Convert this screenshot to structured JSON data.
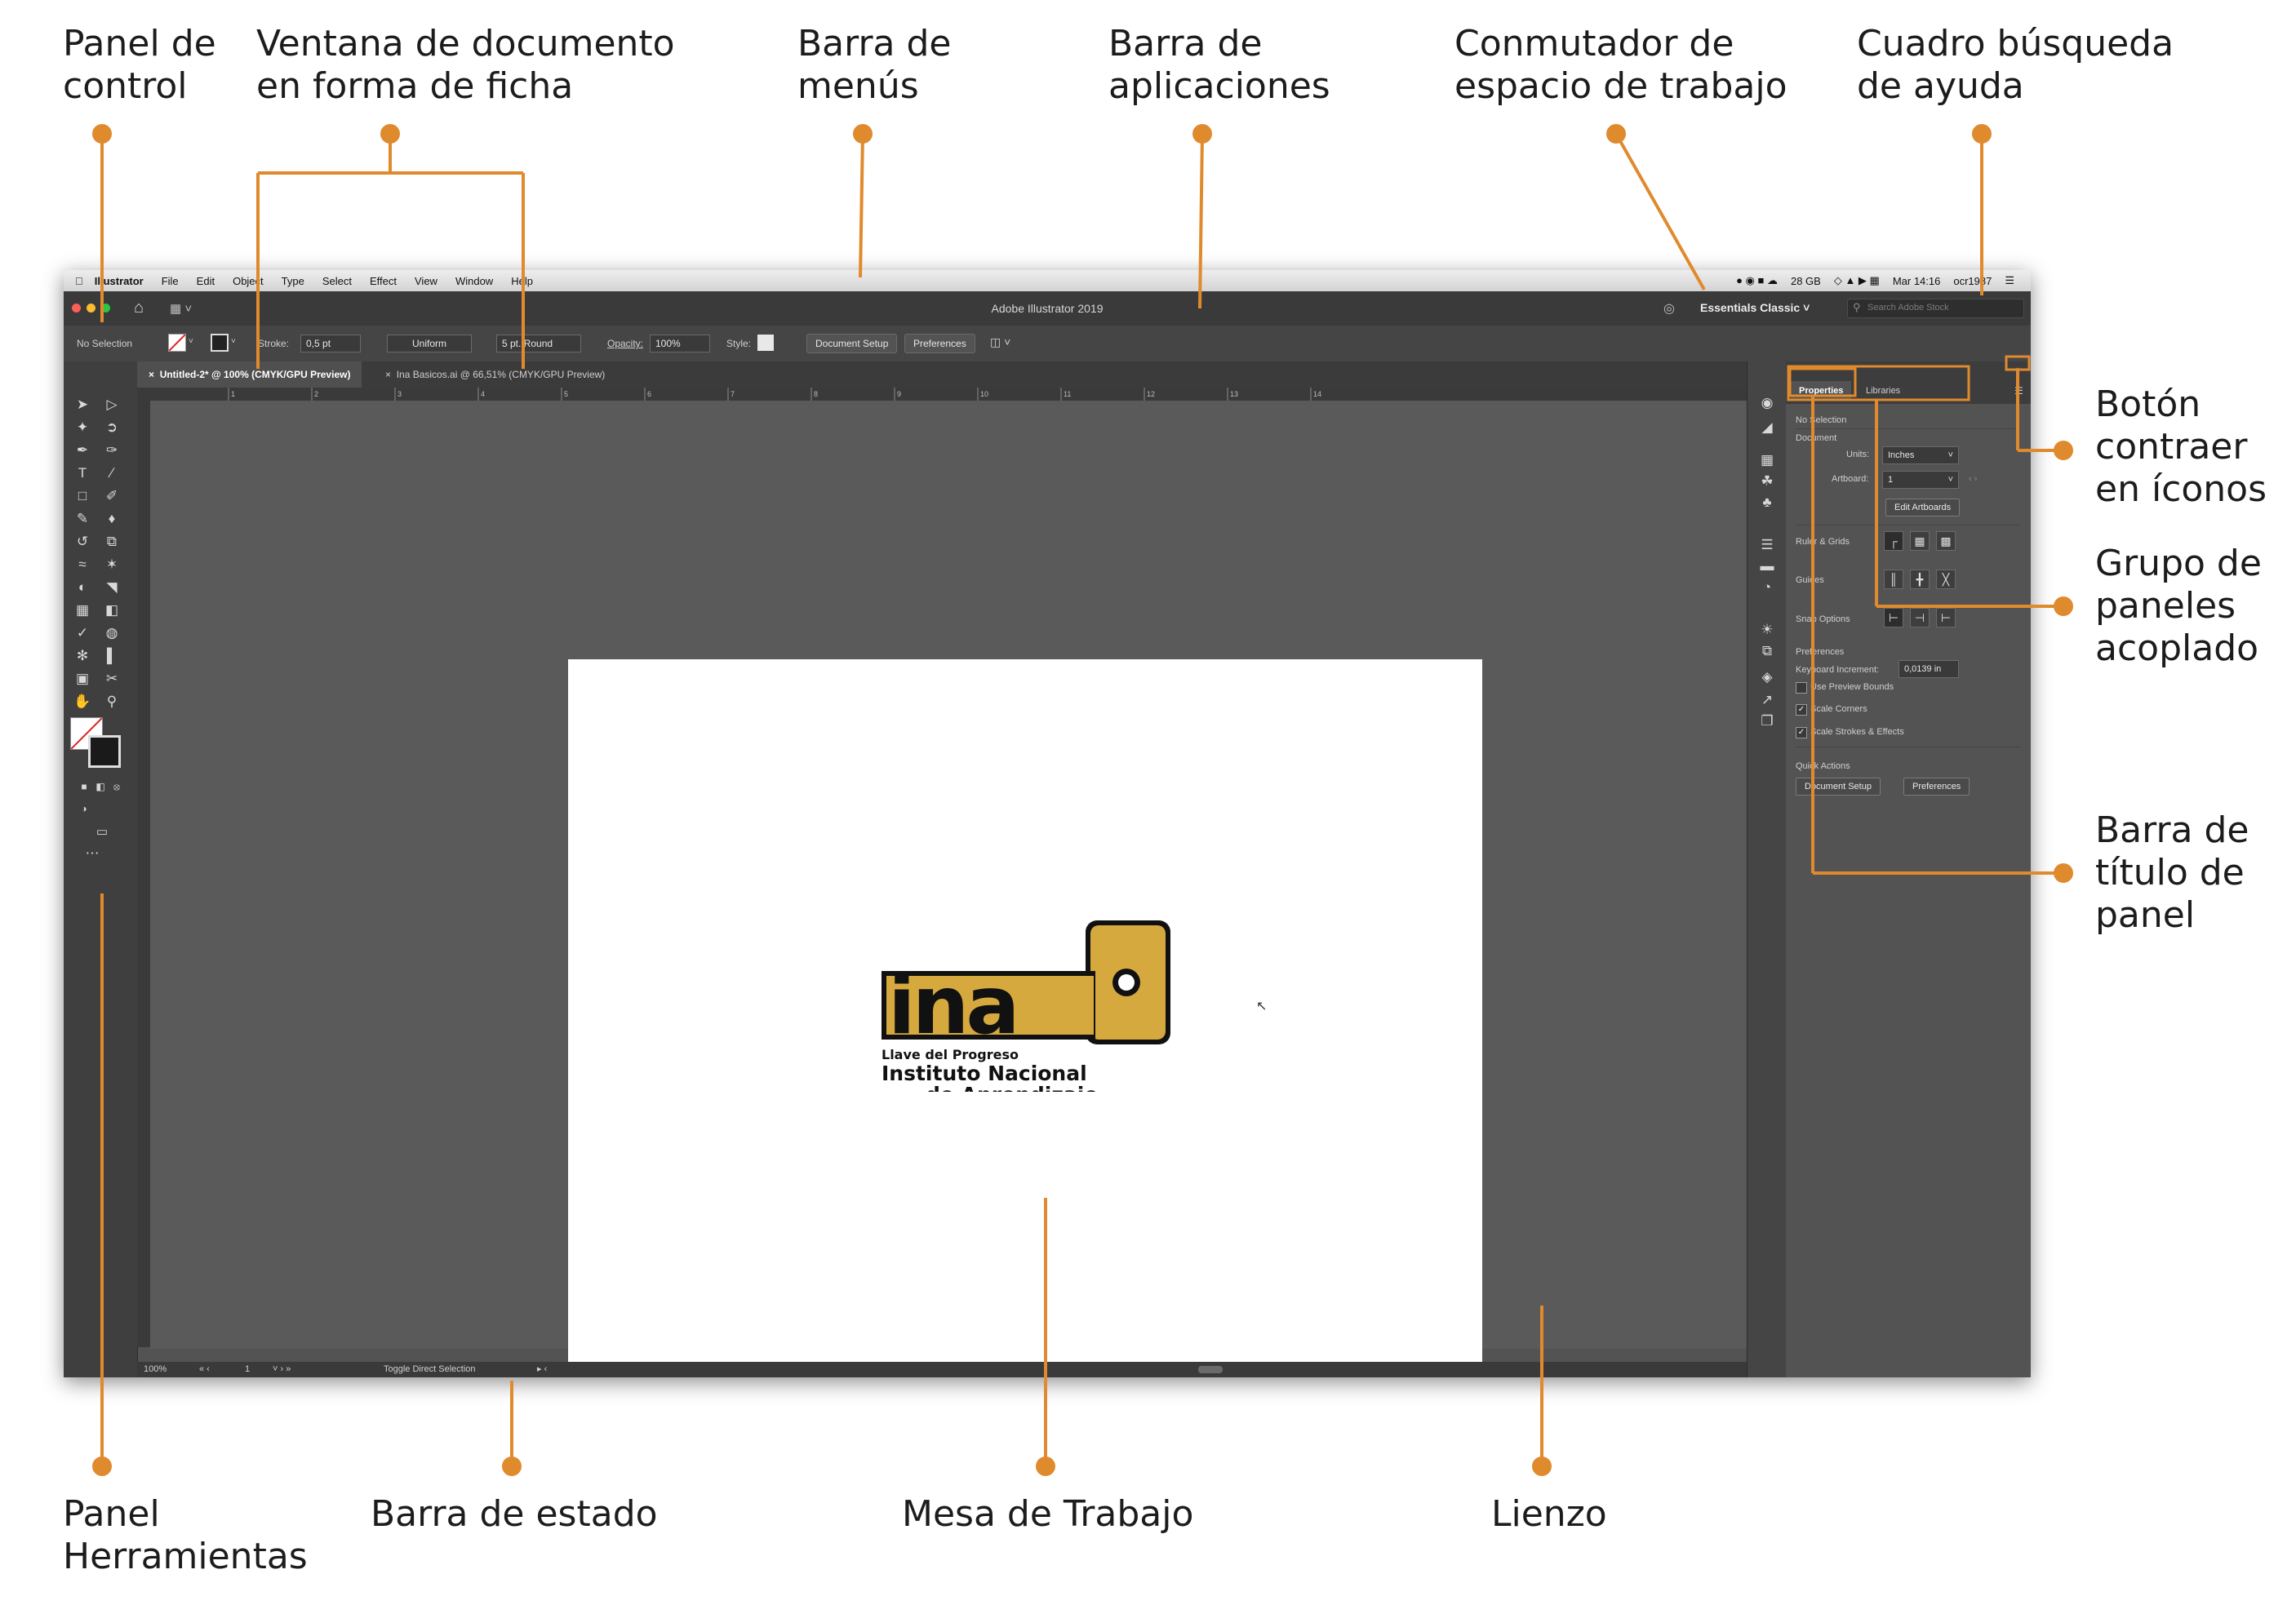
{
  "callouts": {
    "control_panel": "Panel de\ncontrol",
    "tabbed_document": "Ventana de documento\nen forma de ficha",
    "menu_bar": "Barra de\nmenús",
    "app_bar": "Barra de\naplicaciones",
    "workspace_switcher": "Conmutador de\nespacio de trabajo",
    "help_search": "Cuadro búsqueda\nde ayuda",
    "collapse_button": "Botón\ncontraer\nen íconos",
    "docked_panels": "Grupo de\npaneles\nacoplado",
    "panel_title_bar": "Barra de\ntítulo de\npanel",
    "tools_panel": "Panel\nHerramientas",
    "status_bar": "Barra de estado",
    "artboard": "Mesa de Trabajo",
    "canvas": "Lienzo"
  },
  "menubar": {
    "app": "Illustrator",
    "items": [
      "File",
      "Edit",
      "Object",
      "Type",
      "Select",
      "Effect",
      "View",
      "Window",
      "Help"
    ],
    "memory": "28 GB",
    "clock": "Mar 14:16",
    "user": "ocr1987"
  },
  "appbar": {
    "title": "Adobe Illustrator 2019",
    "workspace": "Essentials Classic",
    "search_placeholder": "Search Adobe Stock"
  },
  "control": {
    "selection": "No Selection",
    "stroke_label": "Stroke:",
    "stroke_value": "0,5 pt",
    "profile": "Uniform",
    "brush": "5 pt. Round",
    "opacity_label": "Opacity:",
    "opacity_value": "100%",
    "style_label": "Style:",
    "document_setup": "Document Setup",
    "preferences": "Preferences"
  },
  "tabs": [
    {
      "label": "Untitled-2* @ 100% (CMYK/GPU Preview)",
      "active": true
    },
    {
      "label": "Ina Basicos.ai @ 66,51% (CMYK/GPU Preview)",
      "active": false
    }
  ],
  "ruler_ticks": [
    "1",
    "2",
    "3",
    "4",
    "5",
    "6",
    "7",
    "8",
    "9",
    "10",
    "11",
    "12",
    "13",
    "14"
  ],
  "status": {
    "zoom": "100%",
    "artboard_num": "1",
    "tool_hint": "Toggle Direct Selection"
  },
  "logo": {
    "brand": "ina",
    "slogan": "Llave del Progreso",
    "line1": "Instituto Nacional",
    "line2": "de Aprendizaje",
    "gold": "#d6a93e"
  },
  "properties": {
    "tab_properties": "Properties",
    "tab_libraries": "Libraries",
    "no_selection": "No Selection",
    "document": "Document",
    "units_label": "Units:",
    "units_value": "Inches",
    "artboard_label": "Artboard:",
    "artboard_value": "1",
    "edit_artboards": "Edit Artboards",
    "rulers_grids": "Ruler & Grids",
    "guides": "Guides",
    "snap_options": "Snap Options",
    "preferences_section": "Preferences",
    "keyboard_increment": "Keyboard Increment:",
    "keyboard_value": "0,0139 in",
    "use_preview_bounds": "Use Preview Bounds",
    "scale_corners": "Scale Corners",
    "scale_strokes": "Scale Strokes & Effects",
    "quick_actions": "Quick Actions",
    "qa_document_setup": "Document Setup",
    "qa_preferences": "Preferences"
  },
  "colors": {
    "accent": "#e08a2e",
    "ui_dark": "#535353",
    "canvas": "#5a5a5a"
  }
}
